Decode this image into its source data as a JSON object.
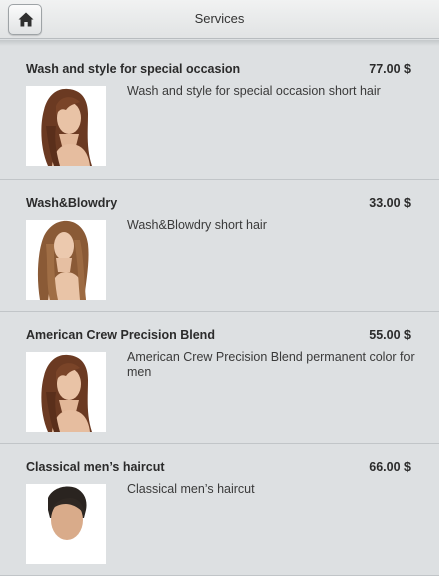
{
  "header": {
    "title": "Services",
    "home_icon": "home-icon"
  },
  "services": [
    {
      "name": "Wash and style for special occasion",
      "price": "77.00 $",
      "description": "Wash and style for special occasion short hair",
      "thumb": "woman-auburn-hair"
    },
    {
      "name": "Wash&Blowdry",
      "price": "33.00 $",
      "description": "Wash&Blowdry short hair",
      "thumb": "woman-long-straight-hair"
    },
    {
      "name": "American Crew Precision Blend",
      "price": "55.00 $",
      "description": "American Crew Precision Blend permanent color for men",
      "thumb": "woman-auburn-hair"
    },
    {
      "name": "Classical men’s haircut",
      "price": "66.00 $",
      "description": "Classical men’s haircut",
      "thumb": "man-short-hair"
    }
  ]
}
